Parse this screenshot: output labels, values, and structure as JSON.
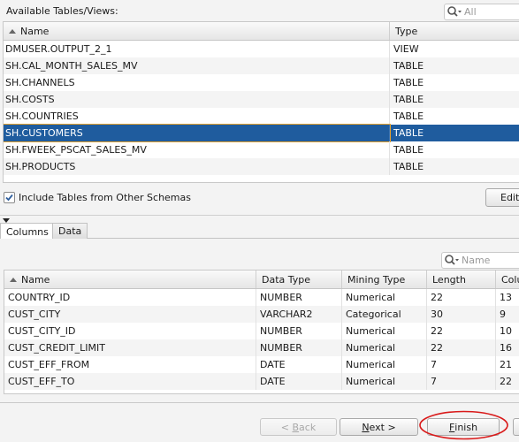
{
  "top_panel": {
    "title": "Available Tables/Views:",
    "search_placeholder": "All",
    "columns": [
      "Name",
      "Type"
    ],
    "rows": [
      {
        "name": "DMUSER.OUTPUT_2_1",
        "type": "VIEW"
      },
      {
        "name": "SH.CAL_MONTH_SALES_MV",
        "type": "TABLE"
      },
      {
        "name": "SH.CHANNELS",
        "type": "TABLE"
      },
      {
        "name": "SH.COSTS",
        "type": "TABLE"
      },
      {
        "name": "SH.COUNTRIES",
        "type": "TABLE"
      },
      {
        "name": "SH.CUSTOMERS",
        "type": "TABLE"
      },
      {
        "name": "SH.FWEEK_PSCAT_SALES_MV",
        "type": "TABLE"
      },
      {
        "name": "SH.PRODUCTS",
        "type": "TABLE"
      }
    ],
    "selected_row": "SH.CUSTOMERS",
    "include_checkbox_label": "Include Tables from Other Schemas",
    "include_checked": true,
    "edit_label": "Edit"
  },
  "tabs": [
    {
      "label": "Columns",
      "active": true
    },
    {
      "label": "Data",
      "active": false
    }
  ],
  "columns_panel": {
    "search_placeholder": "Name",
    "columns": [
      "Name",
      "Data Type",
      "Mining Type",
      "Length",
      "Colu"
    ],
    "rows": [
      {
        "name": "COUNTRY_ID",
        "data_type": "NUMBER",
        "mining_type": "Numerical",
        "length": "22",
        "col": "13"
      },
      {
        "name": "CUST_CITY",
        "data_type": "VARCHAR2",
        "mining_type": "Categorical",
        "length": "30",
        "col": "9"
      },
      {
        "name": "CUST_CITY_ID",
        "data_type": "NUMBER",
        "mining_type": "Numerical",
        "length": "22",
        "col": "10"
      },
      {
        "name": "CUST_CREDIT_LIMIT",
        "data_type": "NUMBER",
        "mining_type": "Numerical",
        "length": "22",
        "col": "16"
      },
      {
        "name": "CUST_EFF_FROM",
        "data_type": "DATE",
        "mining_type": "Numerical",
        "length": "7",
        "col": "21"
      },
      {
        "name": "CUST_EFF_TO",
        "data_type": "DATE",
        "mining_type": "Numerical",
        "length": "7",
        "col": "22"
      }
    ]
  },
  "footer": {
    "back": {
      "prefix": "< ",
      "mnemonic": "B",
      "rest": "ack",
      "enabled": false
    },
    "next": {
      "mnemonic": "N",
      "rest": "ext >",
      "enabled": true
    },
    "finish": {
      "mnemonic": "F",
      "rest": "inish",
      "enabled": true,
      "highlighted": true
    }
  },
  "colors": {
    "selection": "#1f5c9e",
    "highlight_ring": "#d91a1a",
    "checkbox_check": "#2f5f9e"
  }
}
